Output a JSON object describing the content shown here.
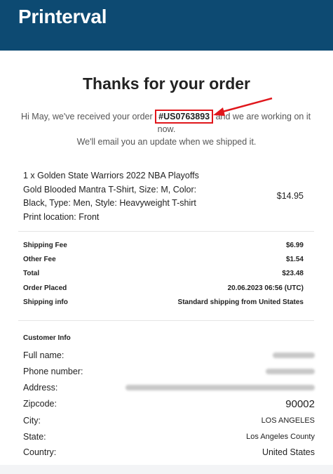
{
  "header": {
    "brand": "Printerval",
    "brand_color": "#0d4a72"
  },
  "confirmation": {
    "title": "Thanks for your order",
    "line_prefix": "Hi May, we've received your order",
    "order_number": "#US0763893",
    "line_suffix": "and we are working on it",
    "line_wrap": "now.",
    "email_note": "We'll email you an update when we shipped it.",
    "highlight_color": "#e0161b"
  },
  "product": {
    "lines": [
      "1 x Golden State Warriors 2022 NBA Playoffs",
      "Gold Blooded Mantra T-Shirt, Size: M, Color:",
      "Black, Type: Men, Style: Heavyweight T-shirt",
      "Print location: Front"
    ],
    "price": "$14.95"
  },
  "summary": [
    {
      "label": "Shipping Fee",
      "value": "$6.99"
    },
    {
      "label": "Other Fee",
      "value": "$1.54"
    },
    {
      "label": "Total",
      "value": "$23.48"
    },
    {
      "label": "Order Placed",
      "value": "20.06.2023 06:56 (UTC)"
    },
    {
      "label": "Shipping info",
      "value": "Standard shipping from United States"
    }
  ],
  "customer": {
    "title": "Customer Info",
    "fields": [
      {
        "label": "Full name:",
        "value": ""
      },
      {
        "label": "Phone number:",
        "value": ""
      },
      {
        "label": "Address:",
        "value": ""
      },
      {
        "label": "Zipcode:",
        "value": "90002"
      },
      {
        "label": "City:",
        "value": "LOS ANGELES"
      },
      {
        "label": "State:",
        "value": "Los Angeles County"
      },
      {
        "label": "Country:",
        "value": "United States"
      }
    ]
  }
}
